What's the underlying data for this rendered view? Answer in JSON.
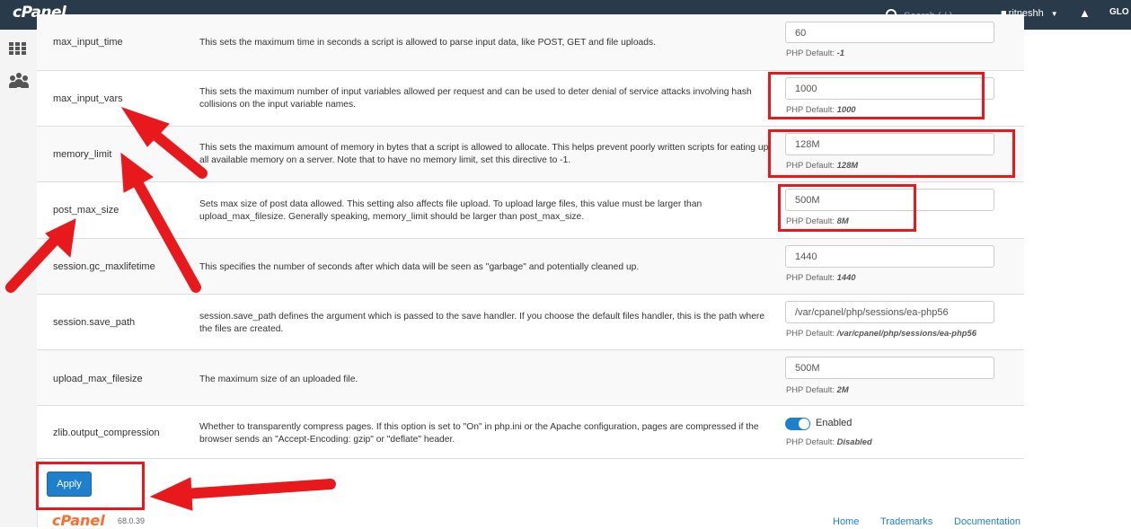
{
  "header": {
    "logo": "cPanel",
    "search_placeholder": "Search ( / )",
    "username": "ritneshh",
    "logout": "LO"
  },
  "rows": [
    {
      "name": "max_input_time",
      "desc": "This sets the maximum time in seconds a script is allowed to parse input data, like POST, GET and file uploads.",
      "value": "60",
      "default_label": "PHP Default:",
      "default": "-1"
    },
    {
      "name": "max_input_vars",
      "desc": "This sets the maximum number of input variables allowed per request and can be used to deter denial of service attacks involving hash collisions on the input variable names.",
      "value": "1000",
      "default_label": "PHP Default:",
      "default": "1000"
    },
    {
      "name": "memory_limit",
      "desc": "This sets the maximum amount of memory in bytes that a script is allowed to allocate. This helps prevent poorly written scripts for eating up all available memory on a server. Note that to have no memory limit, set this directive to -1.",
      "value": "128M",
      "default_label": "PHP Default:",
      "default": "128M"
    },
    {
      "name": "post_max_size",
      "desc": "Sets max size of post data allowed. This setting also affects file upload. To upload large files, this value must be larger than upload_max_filesize. Generally speaking, memory_limit should be larger than post_max_size.",
      "value": "500M",
      "default_label": "PHP Default:",
      "default": "8M"
    },
    {
      "name": "session.gc_maxlifetime",
      "desc": "This specifies the number of seconds after which data will be seen as \"garbage\" and potentially cleaned up.",
      "value": "1440",
      "default_label": "PHP Default:",
      "default": "1440"
    },
    {
      "name": "session.save_path",
      "desc": "session.save_path defines the argument which is passed to the save handler. If you choose the default files handler, this is the path where the files are created.",
      "value": "/var/cpanel/php/sessions/ea-php56",
      "default_label": "PHP Default:",
      "default": "/var/cpanel/php/sessions/ea-php56"
    },
    {
      "name": "upload_max_filesize",
      "desc": "The maximum size of an uploaded file.",
      "value": "500M",
      "default_label": "PHP Default:",
      "default": "2M"
    },
    {
      "name": "zlib.output_compression",
      "desc": "Whether to transparently compress pages. If this option is set to \"On\" in php.ini or the Apache configuration, pages are compressed if the browser sends an \"Accept-Encoding: gzip\" or \"deflate\" header.",
      "value": "Enabled",
      "default_label": "PHP Default:",
      "default": "Disabled"
    }
  ],
  "apply_label": "Apply",
  "footer": {
    "logo": "cPanel",
    "version": "68.0.39",
    "links": [
      "Home",
      "Trademarks",
      "Documentation"
    ]
  },
  "colors": {
    "topbar": "#293a4a",
    "accent": "#1e7fcb",
    "annotation": "#e8191d",
    "footer_logo": "#ff6c2c"
  }
}
